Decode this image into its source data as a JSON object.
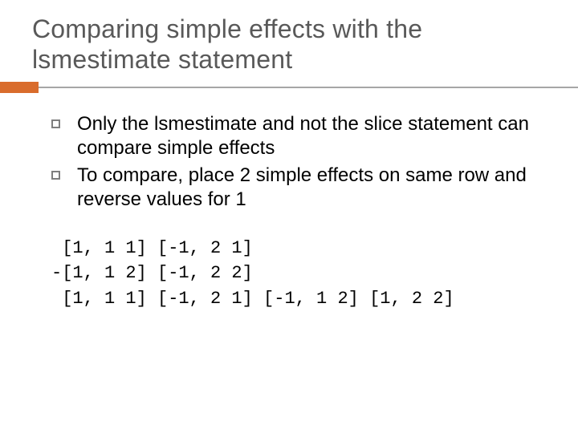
{
  "title": "Comparing simple effects with the lsmestimate statement",
  "bullets": [
    "Only the lsmestimate and not the slice statement can compare simple effects",
    "To compare, place 2 simple effects on same row and reverse values for 1"
  ],
  "code_lines": [
    " [1, 1 1] [-1, 2 1]",
    "-[1, 1 2] [-1, 2 2]",
    " [1, 1 1] [-1, 2 1] [-1, 1 2] [1, 2 2]"
  ]
}
